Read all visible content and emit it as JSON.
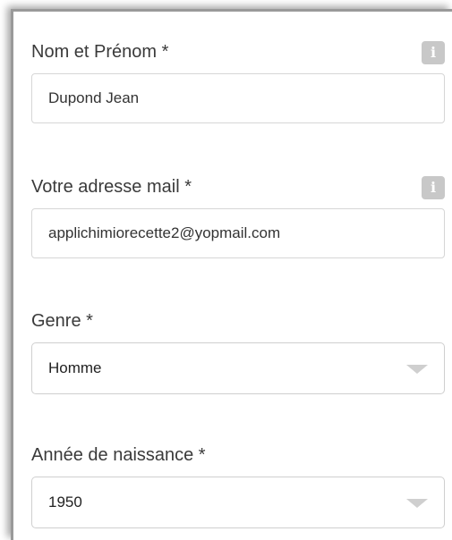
{
  "form": {
    "name_field": {
      "label": "Nom et Prénom *",
      "value": "Dupond Jean",
      "info_icon": "info-icon"
    },
    "email_field": {
      "label": "Votre adresse mail *",
      "value": "applichimiorecette2@yopmail.com",
      "info_icon": "info-icon"
    },
    "gender_field": {
      "label": "Genre *",
      "selected": "Homme",
      "icon": "chevron-down-icon"
    },
    "birth_year_field": {
      "label": "Année de naissance *",
      "selected": "1950",
      "icon": "chevron-down-icon"
    }
  },
  "info_icon_glyph": "i",
  "colors": {
    "label_text": "#3a3a3a",
    "input_border": "#d6d6d6",
    "info_icon_bg": "#c8c8c8",
    "chevron": "#cfcfcf"
  }
}
